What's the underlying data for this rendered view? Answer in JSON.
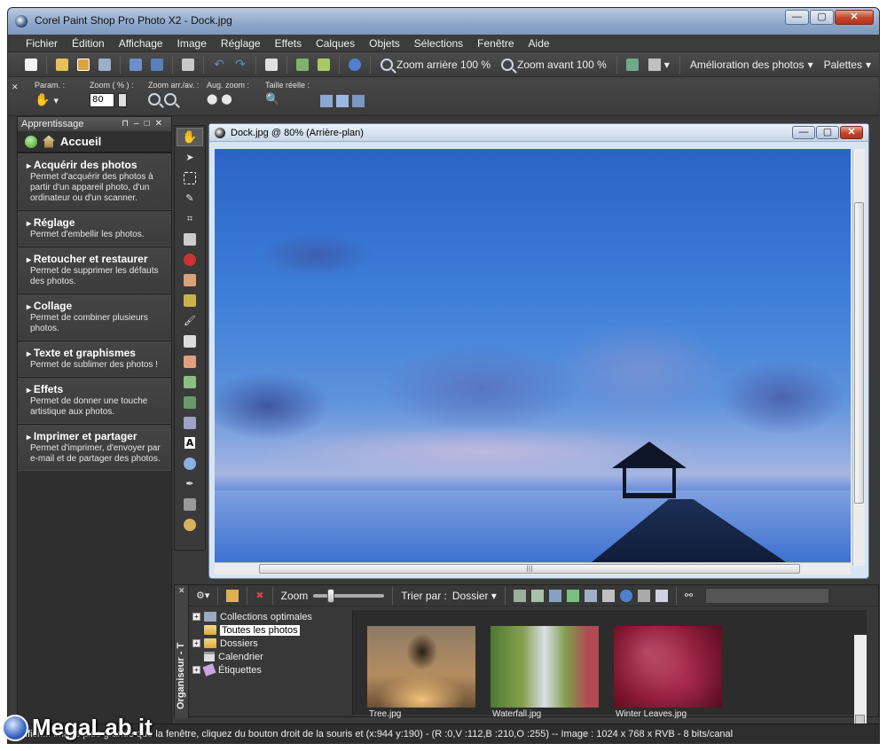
{
  "window": {
    "title": "Corel Paint Shop Pro Photo X2 - Dock.jpg",
    "buttons": {
      "minimize": "—",
      "maximize": "▢",
      "close": "✕"
    }
  },
  "menu": [
    {
      "label": "Fichier"
    },
    {
      "label": "Édition"
    },
    {
      "label": "Affichage"
    },
    {
      "label": "Image"
    },
    {
      "label": "Réglage"
    },
    {
      "label": "Effets"
    },
    {
      "label": "Calques"
    },
    {
      "label": "Objets"
    },
    {
      "label": "Sélections"
    },
    {
      "label": "Fenêtre"
    },
    {
      "label": "Aide"
    }
  ],
  "toolbar": {
    "zoom_out_label": "Zoom arrière 100 %",
    "zoom_in_label": "Zoom avant 100 %",
    "enhance_label": "Amélioration des photos",
    "palettes_label": "Palettes"
  },
  "tool_options": {
    "param_label": "Param. :",
    "zoom_label": "Zoom ( % ) :",
    "zoom_value": "80",
    "zoom_inout_label": "Zoom arr./av. :",
    "aug_zoom_label": "Aug. zoom :",
    "actual_size_label": "Taille réelle :"
  },
  "learning_panel": {
    "title": "Apprentissage",
    "home_label": "Accueil",
    "sections": [
      {
        "title": "Acquérir des photos",
        "desc": "Permet d'acquérir des photos à partir d'un appareil photo, d'un ordinateur ou d'un scanner."
      },
      {
        "title": "Réglage",
        "desc": "Permet d'embellir les photos."
      },
      {
        "title": "Retoucher et restaurer",
        "desc": "Permet de supprimer les défauts des photos."
      },
      {
        "title": "Collage",
        "desc": "Permet de combiner plusieurs photos."
      },
      {
        "title": "Texte et graphismes",
        "desc": "Permet de sublimer des photos !"
      },
      {
        "title": "Effets",
        "desc": "Permet de donner une touche artistique aux photos."
      },
      {
        "title": "Imprimer et partager",
        "desc": "Permet d'imprimer, d'envoyer par e-mail et de partager des photos."
      }
    ]
  },
  "image_window": {
    "title": "Dock.jpg @  80% (Arrière-plan)"
  },
  "organizer": {
    "side_label": "Organiseur - T",
    "zoom_label": "Zoom",
    "sort_label": "Trier par :",
    "sort_value": "Dossier",
    "tree": [
      {
        "label": "Collections optimales",
        "expand": "+"
      },
      {
        "label": "Toutes les photos"
      },
      {
        "label": "Dossiers",
        "expand": "+"
      },
      {
        "label": "Calendrier"
      },
      {
        "label": "Étiquettes",
        "expand": "+"
      }
    ],
    "thumbnails": [
      {
        "caption": "Tree.jpg"
      },
      {
        "caption": "Waterfall.jpg"
      },
      {
        "caption": "Winter Leaves.jpg"
      }
    ]
  },
  "status": {
    "text": "...ffich... image plus grande que la fenêtre, cliquez du bouton droit de la souris et    (x:944 y:190) - (R :0,V :112,B :210,O :255) -- Image : 1024 x 768 x RVB - 8 bits/canal"
  },
  "watermark": {
    "text": "MegaLab.it"
  },
  "colors": {
    "accent": "#3a66c4",
    "panel": "#3a3a3a",
    "sky": "#3d7fd9"
  }
}
